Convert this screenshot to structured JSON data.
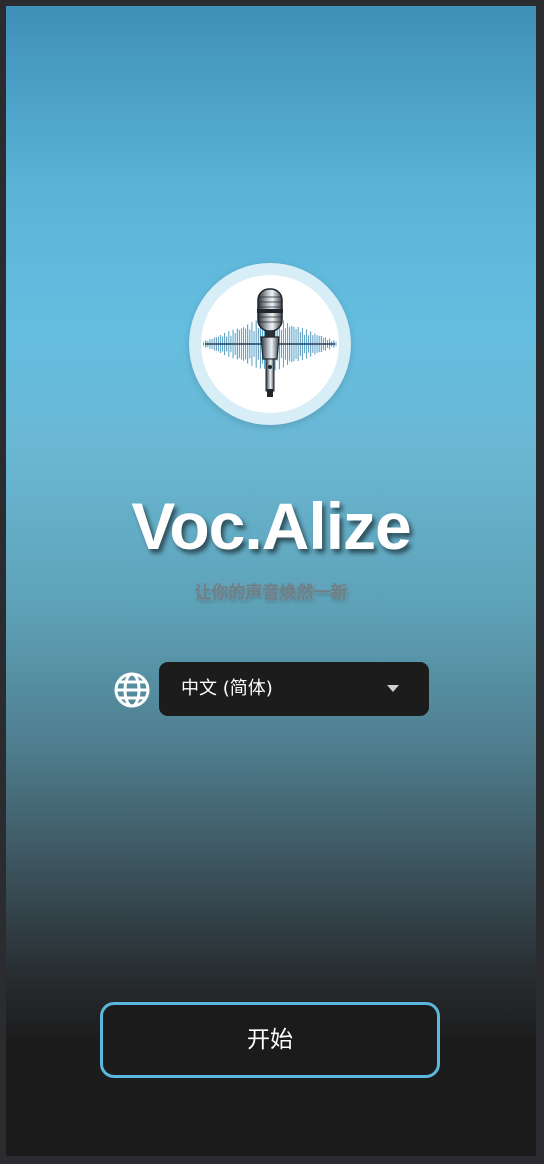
{
  "app": {
    "title": "Voc.Alize",
    "tagline": "让你的声音焕然一新",
    "logo_icon": "microphone-soundwave-icon"
  },
  "language": {
    "icon": "globe-icon",
    "selected": "中文 (简体)",
    "dropdown_icon": "caret-down-icon"
  },
  "actions": {
    "start_label": "开始"
  },
  "colors": {
    "accent": "#5ab8de",
    "background_top": "#3f8fb8",
    "background_bottom": "#1b1b1b",
    "control_bg": "#1c1c1c"
  }
}
